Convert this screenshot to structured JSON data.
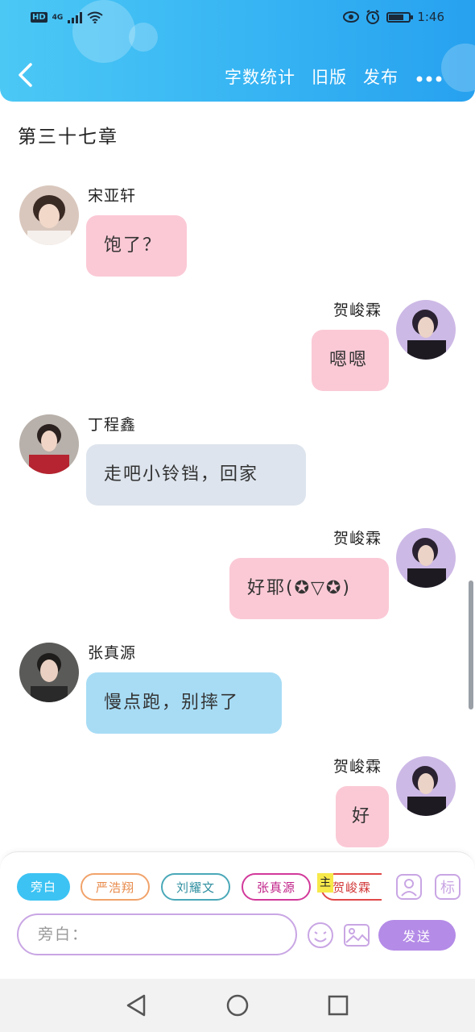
{
  "status_bar": {
    "hd": "HD",
    "network": "4G",
    "time": "1:46",
    "battery_level": 0.75
  },
  "header": {
    "back_icon": "chevron-left-icon",
    "actions": [
      "字数统计",
      "旧版",
      "发布"
    ],
    "more_icon": "more-dots-icon"
  },
  "chapter_title": "第三十七章",
  "messages": [
    {
      "name": "宋亚轩",
      "text": "饱了？",
      "side": "left",
      "color": "#fbc9d6"
    },
    {
      "name": "贺峻霖",
      "text": "嗯嗯",
      "side": "right",
      "color": "#fbc9d6"
    },
    {
      "name": "丁程鑫",
      "text": "走吧小铃铛，回家",
      "side": "left",
      "color": "#dde4ed"
    },
    {
      "name": "贺峻霖",
      "text": "好耶(✪▽✪)",
      "side": "right",
      "color": "#fbc9d6"
    },
    {
      "name": "张真源",
      "text": "慢点跑，别摔了",
      "side": "left",
      "color": "#a8dcf5"
    },
    {
      "name": "贺峻霖",
      "text": "好",
      "side": "right",
      "color": "#fbc9d6"
    }
  ],
  "roles": [
    "旁白",
    "严浩翔",
    "刘耀文",
    "张真源",
    "贺峻霖"
  ],
  "main_tag": "主",
  "tag_button": "标",
  "input": {
    "placeholder": "旁白："
  },
  "send_label": "发送",
  "colors": {
    "header_start": "#4cc8f5",
    "header_end": "#27a1ef",
    "accent": "#b48be7",
    "narration": "#3cc3f3"
  }
}
